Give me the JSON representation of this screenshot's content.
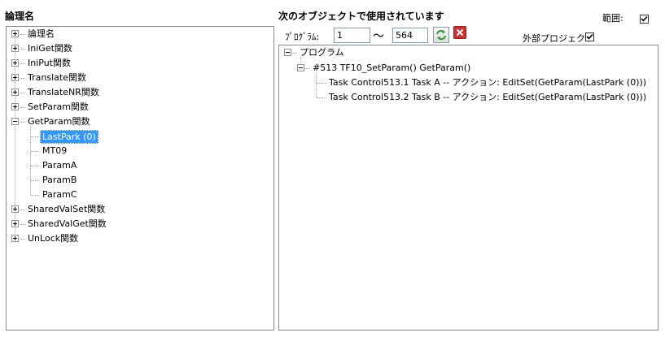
{
  "left_panel": {
    "header": "論理名",
    "tree": [
      {
        "label": "論理名",
        "expanded": false
      },
      {
        "label": "IniGet関数",
        "expanded": false
      },
      {
        "label": "IniPut関数",
        "expanded": false
      },
      {
        "label": "Translate関数",
        "expanded": false
      },
      {
        "label": "TranslateNR関数",
        "expanded": false
      },
      {
        "label": "SetParam関数",
        "expanded": false
      },
      {
        "label": "GetParam関数",
        "expanded": true,
        "children": [
          "LastPark (0)",
          "MT09",
          "ParamA",
          "ParamB",
          "ParamC"
        ],
        "selected_child": "LastPark (0)"
      },
      {
        "label": "SharedValSet関数",
        "expanded": false
      },
      {
        "label": "SharedValGet関数",
        "expanded": false
      },
      {
        "label": "UnLock関数",
        "expanded": false
      }
    ]
  },
  "right_panel": {
    "header": "次のオブジェクトで使用されています",
    "range_label": "範囲:",
    "range_checked": true,
    "program_label": "ﾌﾟﾛｸﾞﾗﾑ:",
    "from_value": "1",
    "tilde": "〜",
    "to_value": "564",
    "external_label": "外部プロジェクト",
    "external_checked": true,
    "tree": {
      "root": "プログラム",
      "program": "#513 TF10_SetParam() GetParam()",
      "tasks": [
        "Task Control513.1  Task A -- アクション: EditSet(GetParam(LastPark (0)))",
        "Task Control513.2  Task B -- アクション: EditSet(GetParam(LastPark (0)))"
      ]
    }
  },
  "colors": {
    "selection": "#3399ff",
    "border": "#828790",
    "refresh_green": "#2e9b2e",
    "clear_red": "#d03030"
  }
}
